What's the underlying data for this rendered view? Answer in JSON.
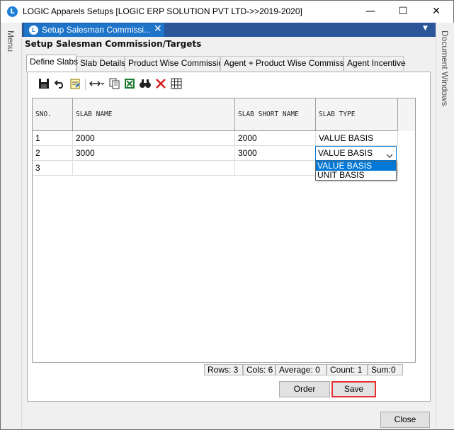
{
  "window": {
    "title": "LOGIC Apparels Setups  [LOGIC ERP SOLUTION PVT LTD->>2019-2020]",
    "icon_letter": "L",
    "minimize_glyph": "—",
    "maximize_glyph": "☐",
    "close_glyph": "✕"
  },
  "side_panels": {
    "left_label": "Menu",
    "right_label": "Document Windows"
  },
  "doc_tab": {
    "label": "Setup Salesman Commissi...",
    "icon_letter": "L",
    "close_glyph": "✕",
    "menu_arrow": "▼"
  },
  "form": {
    "heading": "Setup Salesman Commission/Targets",
    "tabs": [
      {
        "label": "Define Slabs",
        "active": true
      },
      {
        "label": "Slab Details",
        "active": false
      },
      {
        "label": "Product Wise Commission",
        "active": false
      },
      {
        "label": "Agent + Product Wise Commission",
        "active": false
      },
      {
        "label": "Agent Incentive",
        "active": false
      }
    ],
    "toolbar": [
      "save-icon",
      "undo-icon",
      "notes-icon",
      "resize-columns-icon",
      "copy-icon",
      "excel-icon",
      "find-icon",
      "delete-icon",
      "grid-icon"
    ],
    "grid": {
      "columns": [
        "SNO.",
        "SLAB NAME",
        "SLAB SHORT NAME",
        "SLAB TYPE"
      ],
      "rows": [
        {
          "sno": "1",
          "slab_name": "2000",
          "slab_short_name": "2000",
          "slab_type": "VALUE BASIS"
        },
        {
          "sno": "2",
          "slab_name": "3000",
          "slab_short_name": "3000",
          "slab_type": "VALUE BASIS"
        },
        {
          "sno": "3",
          "slab_name": "",
          "slab_short_name": "",
          "slab_type": ""
        }
      ],
      "dropdown_options": [
        {
          "label": "VALUE BASIS",
          "selected": true
        },
        {
          "label": "UNIT BASIS",
          "selected": false
        }
      ]
    },
    "status": {
      "rows": "Rows: 3",
      "cols": "Cols: 6",
      "average": "Average: 0",
      "count": "Count: 1",
      "sum": "Sum:0"
    },
    "buttons": {
      "order": "Order",
      "save": "Save"
    }
  },
  "footer": {
    "close": "Close"
  },
  "colors": {
    "accent": "#0078d7",
    "doc_tab_bar": "#2b579a",
    "save_highlight": "#e53030"
  }
}
